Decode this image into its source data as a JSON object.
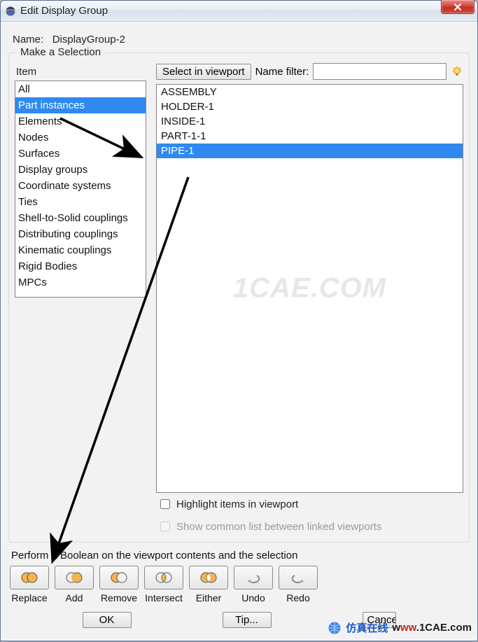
{
  "window": {
    "title": "Edit Display Group"
  },
  "name_row": {
    "label": "Name:",
    "value": "DisplayGroup-2"
  },
  "selection_box": {
    "legend": "Make a Selection",
    "item_label": "Item",
    "items": [
      "All",
      "Part instances",
      "Elements",
      "Nodes",
      "Surfaces",
      "Display groups",
      "Coordinate systems",
      "Ties",
      "Shell-to-Solid couplings",
      "Distributing couplings",
      "Kinematic couplings",
      "Rigid Bodies",
      "MPCs"
    ],
    "item_selected_index": 1,
    "select_in_viewport_btn": "Select in viewport",
    "name_filter_label": "Name filter:",
    "name_filter_value": "",
    "entries": [
      "ASSEMBLY",
      "HOLDER-1",
      "INSIDE-1",
      "PART-1-1",
      "PIPE-1"
    ],
    "entry_selected_index": 4,
    "highlight_label": "Highlight items in viewport",
    "highlight_checked": false,
    "common_label": "Show common list between linked viewports",
    "common_enabled": false
  },
  "boolean": {
    "text": "Perform a Boolean on the viewport contents and the selection",
    "buttons": [
      "Replace",
      "Add",
      "Remove",
      "Intersect",
      "Either",
      "Undo",
      "Redo"
    ]
  },
  "dialog_buttons": {
    "ok": "OK",
    "tip": "Tip...",
    "cancel": "Cancel"
  },
  "watermark_main": "1CAE.COM",
  "site_mark": {
    "cn": "仿真在线",
    "url_pre": "w",
    "url_red": "ww",
    "url_post": ".1CAE.com"
  },
  "colors": {
    "selection": "#2f89ef",
    "titlebar_start": "#f6f9fe",
    "close_red": "#c22e22"
  }
}
